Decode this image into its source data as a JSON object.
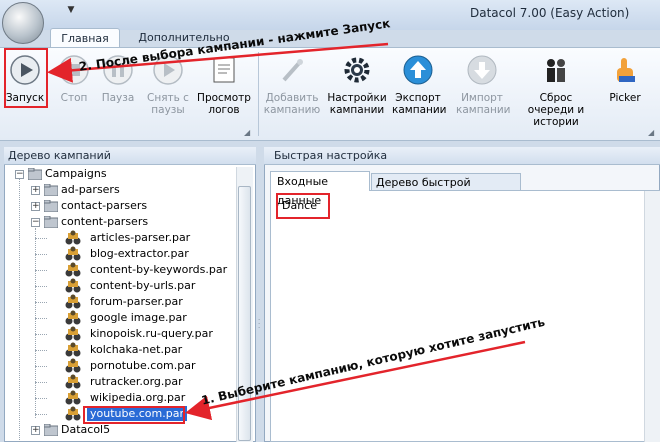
{
  "window": {
    "title": "Datacol 7.00 (Easy Action)",
    "qat_glyph": "▼"
  },
  "ribbon": {
    "tabs": [
      {
        "label": "Главная"
      },
      {
        "label": "Дополнительно"
      }
    ],
    "buttons": [
      {
        "label": "Запуск",
        "icon": "play-icon",
        "enabled": true
      },
      {
        "label": "Стоп",
        "icon": "stop-icon",
        "enabled": false
      },
      {
        "label": "Пауза",
        "icon": "pause-icon",
        "enabled": false
      },
      {
        "label": "Снять с паузы",
        "icon": "resume-icon",
        "enabled": false
      },
      {
        "label": "Просмотр логов",
        "icon": "log-icon",
        "enabled": true
      },
      {
        "label": "Добавить кампанию",
        "icon": "add-campaign-icon",
        "enabled": false
      },
      {
        "label": "Настройки кампании",
        "icon": "gear-icon",
        "enabled": true
      },
      {
        "label": "Экспорт кампании",
        "icon": "export-icon",
        "enabled": true
      },
      {
        "label": "Импорт кампании",
        "icon": "import-icon",
        "enabled": false
      },
      {
        "label": "Сброс очереди и истории",
        "icon": "reset-icon",
        "enabled": true
      },
      {
        "label": "Picker",
        "icon": "picker-icon",
        "enabled": true
      }
    ]
  },
  "tree": {
    "header": "Дерево кампаний",
    "root": "Campaigns",
    "groups": [
      "ad-parsers",
      "contact-parsers",
      "content-parsers"
    ],
    "items": [
      "articles-parser.par",
      "blog-extractor.par",
      "content-by-keywords.par",
      "content-by-urls.par",
      "forum-parser.par",
      "google image.par",
      "kinopoisk.ru-query.par",
      "kolchaka-net.par",
      "pornotube.com.par",
      "rutracker.org.par",
      "wikipedia.org.par",
      "youtube.com.par"
    ],
    "selected": "youtube.com.par",
    "last_group": "Datacol5"
  },
  "quick": {
    "header": "Быстрая настройка",
    "tabs": [
      {
        "label": "Входные данные"
      },
      {
        "label": "Дерево быстрой настройки"
      }
    ],
    "input_value": "Dance"
  },
  "annotations": {
    "step1": "1. Выберите кампанию, которую хотите запустить",
    "step2": "2. После выбора кампании - нажмите Запуск"
  },
  "colors": {
    "annotation_red": "#e3242b",
    "selection_blue": "#2a6bd6"
  }
}
